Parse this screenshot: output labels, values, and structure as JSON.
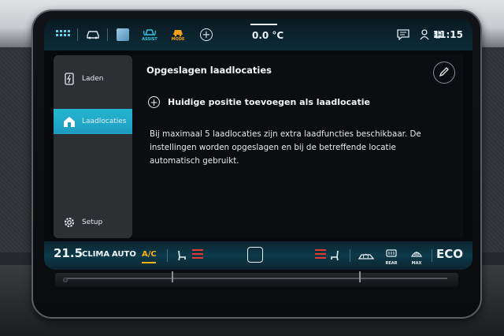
{
  "status_bar": {
    "icons": [
      "apps-grid-icon",
      "car-icon",
      "media-icon",
      "assist-icon",
      "mode-icon",
      "add-icon",
      "message-icon",
      "user-icon",
      "network-icon"
    ],
    "assist_label": "ASSIST",
    "mode_label": "MODE",
    "outside_temp": "0.0 °C",
    "clock": "11:15"
  },
  "sidebar": {
    "items": [
      {
        "label": "Laden",
        "icon": "charge-icon"
      },
      {
        "label": "Laadlocaties",
        "icon": "charging-location-icon",
        "active": true
      },
      {
        "label": "Setup",
        "icon": "gear-icon"
      }
    ]
  },
  "main": {
    "title": "Opgeslagen laadlocaties",
    "add_label": "Huidige positie toevoegen als laadlocatie",
    "description": "Bij maximaal 5 laadlocaties zijn extra laadfuncties beschikbaar. De instellingen worden opgeslagen en bij de betreffende locatie automatisch gebruikt."
  },
  "climate_bar": {
    "temp_value": "21.5",
    "clima_label": "CLIMA",
    "auto_label": "AUTO",
    "ac_label": "A/C",
    "rear_label": "REAR",
    "max_label": "MAX",
    "eco_label": "ECO",
    "accent_color": "#e23a2e",
    "ac_color": "#f5b21b"
  }
}
